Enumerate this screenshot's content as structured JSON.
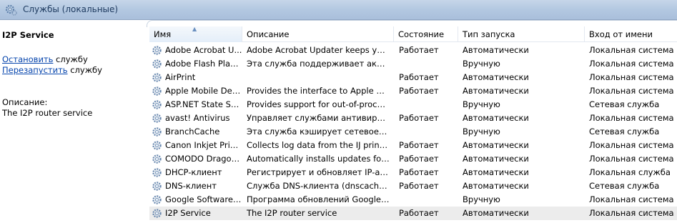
{
  "header": {
    "title": "Службы (локальные)",
    "icon": "services-gear-icon"
  },
  "left": {
    "service_title": "I2P Service",
    "actions": [
      {
        "link": "Остановить",
        "rest": " службу"
      },
      {
        "link": "Перезапустить",
        "rest": " службу"
      }
    ],
    "description_label": "Описание:",
    "description": "The I2P router service"
  },
  "columns": [
    "Имя",
    "Описание",
    "Состояние",
    "Тип запуска",
    "Вход от имени"
  ],
  "services": [
    {
      "name": "Adobe Acrobat U...",
      "desc": "Adobe Acrobat Updater keeps your ...",
      "state": "Работает",
      "start": "Автоматически",
      "logon": "Локальная система"
    },
    {
      "name": "Adobe Flash Playe...",
      "desc": "Эта служба поддерживает актуаль...",
      "state": "",
      "start": "Вручную",
      "logon": "Локальная система"
    },
    {
      "name": "AirPrint",
      "desc": "",
      "state": "Работает",
      "start": "Автоматически",
      "logon": "Локальная система"
    },
    {
      "name": "Apple Mobile Devi...",
      "desc": "Provides the interface to Apple mob...",
      "state": "Работает",
      "start": "Автоматически",
      "logon": "Локальная система"
    },
    {
      "name": "ASP.NET State Ser...",
      "desc": "Provides support for out-of-process...",
      "state": "",
      "start": "Вручную",
      "logon": "Сетевая служба"
    },
    {
      "name": "avast! Antivirus",
      "desc": "Управляет службами антивируса ...",
      "state": "Работает",
      "start": "Автоматически",
      "logon": "Локальная система"
    },
    {
      "name": "BranchCache",
      "desc": "Эта служба кэширует сетевое сод...",
      "state": "",
      "start": "Вручную",
      "logon": "Сетевая служба"
    },
    {
      "name": "Canon Inkjet Print...",
      "desc": "Collects log data from the IJ printer ...",
      "state": "Работает",
      "start": "Автоматически",
      "logon": "Локальная система"
    },
    {
      "name": "COMODO Dragon...",
      "desc": "Automatically installs updates for C...",
      "state": "Работает",
      "start": "Автоматически",
      "logon": "Локальная система"
    },
    {
      "name": "DHCP-клиент",
      "desc": "Регистрирует и обновляет IP-адре...",
      "state": "Работает",
      "start": "Автоматически",
      "logon": "Локальная служба"
    },
    {
      "name": "DNS-клиент",
      "desc": "Служба DNS-клиента (dnscache) ...",
      "state": "Работает",
      "start": "Автоматически",
      "logon": "Сетевая служба"
    },
    {
      "name": "Google Software ...",
      "desc": "Программа обновлений Google с...",
      "state": "",
      "start": "Вручную",
      "logon": "Локальная система"
    },
    {
      "name": "I2P Service",
      "desc": "The I2P router service",
      "state": "Работает",
      "start": "Автоматически",
      "logon": "Локальная система"
    }
  ],
  "selected_service": "I2P Service"
}
